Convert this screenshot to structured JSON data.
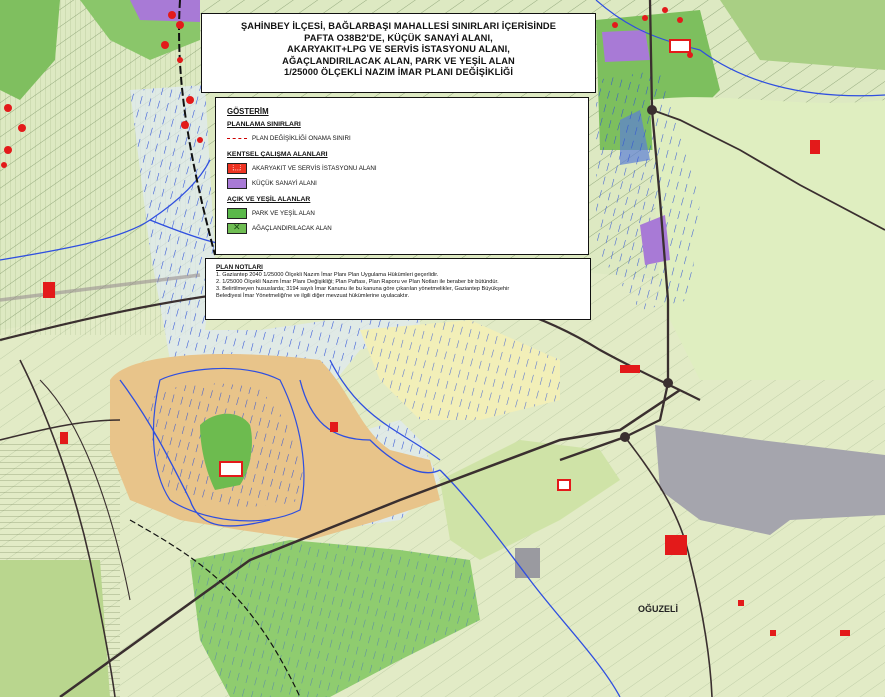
{
  "title": {
    "lines": [
      "ŞAHİNBEY İLÇESİ, BAĞLARBAŞI MAHALLESİ SINIRLARI İÇERİSİNDE",
      "PAFTA O38B2'DE, KÜÇÜK SANAYİ ALANI,",
      "AKARYAKIT+LPG VE SERVİS İSTASYONU ALANI,",
      "AĞAÇLANDIRILACAK ALAN, PARK VE YEŞİL ALAN",
      "1/25000 ÖLÇEKLİ NAZIM İMAR PLANI DEĞİŞİKLİĞİ"
    ]
  },
  "legend": {
    "heading": "GÖSTERİM",
    "sections": [
      {
        "title": "PLANLAMA SINIRLARI",
        "items": [
          {
            "label": "PLAN DEĞİŞİKLİĞİ ONAMA SINIRI",
            "symbol": "dashed-red-line",
            "color": "#cc0000"
          }
        ]
      },
      {
        "title": "KENTSEL ÇALIŞMA ALANLARI",
        "items": [
          {
            "label": "AKARYAKIT VE SERVİS İSTASYONU ALANI",
            "symbol": "fuel-station-swatch",
            "color": "#e33322"
          },
          {
            "label": "KÜÇÜK SANAYİ ALANI",
            "symbol": "industry-swatch",
            "color": "#a87ad6"
          }
        ]
      },
      {
        "title": "AÇIK VE YEŞİL ALANLAR",
        "items": [
          {
            "label": "PARK VE YEŞİL ALAN",
            "symbol": "park-swatch",
            "color": "#5ab84a"
          },
          {
            "label": "AĞAÇLANDIRILACAK ALAN",
            "symbol": "afforestation-swatch",
            "color": "#6fbd53"
          }
        ]
      }
    ]
  },
  "notes": {
    "heading": "PLAN NOTLARI",
    "lines": [
      "1. Gaziantep 2040 1/25000 Ölçekli Nazım İmar Planı Plan Uygulama Hükümleri geçerlidir.",
      "2. 1/25000 Ölçekli Nazım İmar Planı Değişikliği; Plan Paftası, Plan Raporu ve Plan Notları ile beraber bir bütündür.",
      "3. Belirtilmeyen hususlarda; 3194 sayılı İmar Kanunu ile bu kanuna göre çıkarılan yönetmelikler, Gaziantep Büyükşehir",
      "Belediyesi İmar Yönetmeliği'ne ve ilgili diğer mevzuat hükümlerine uyulacaktır."
    ]
  },
  "map": {
    "place_label": "OĞUZELİ",
    "colors": {
      "base_green": "#dde9c2",
      "forest_green": "#7fbf5f",
      "orange_zone": "#e8c48a",
      "industry_gray": "#a5a5ad",
      "purple_zone": "#a87ad6",
      "yellow_zone": "#f0ecb0",
      "river_blue": "#2f4fe0",
      "road_dark": "#3a2f2f",
      "marker_red": "#e31a1a"
    }
  }
}
